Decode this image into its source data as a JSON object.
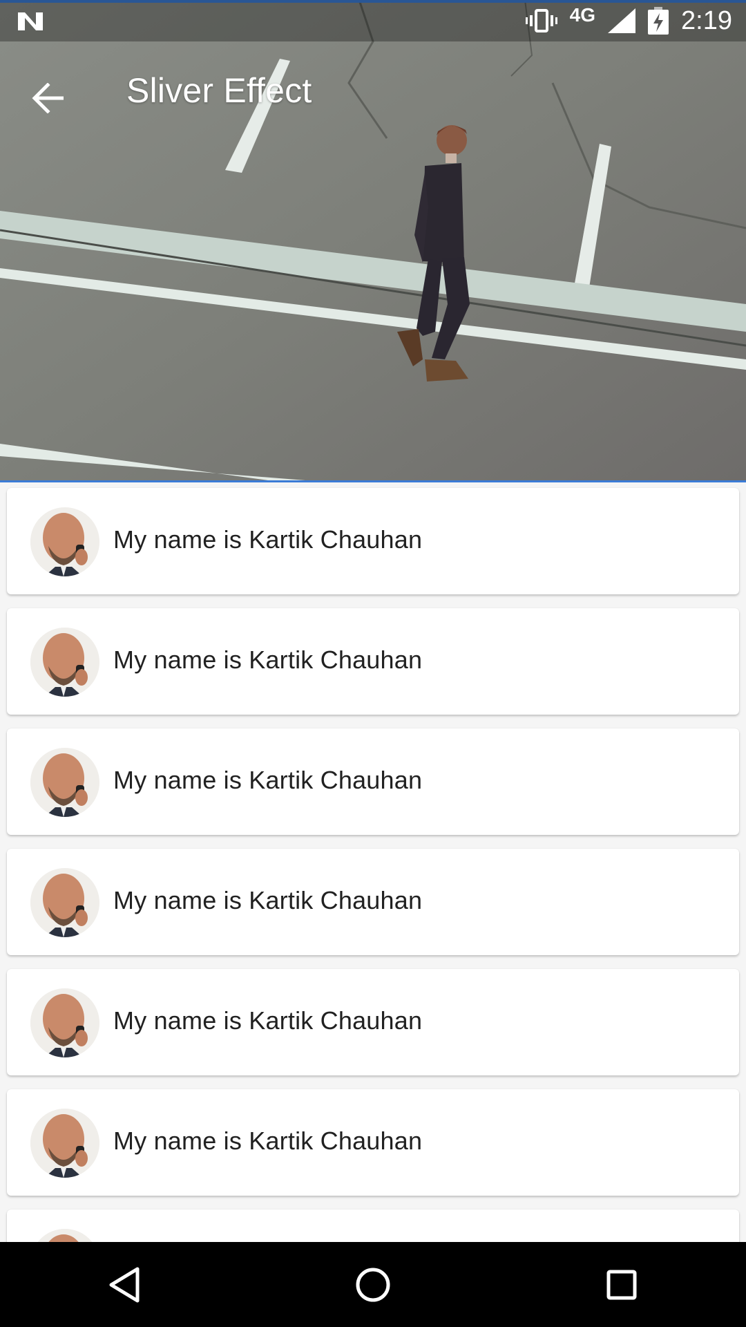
{
  "status_bar": {
    "time": "2:19",
    "network": "4G",
    "icons": [
      "notification-n-icon",
      "vibrate-icon",
      "signal-icon",
      "battery-charging-icon"
    ]
  },
  "app_bar": {
    "title": "Sliver Effect",
    "back_icon": "back-arrow-icon"
  },
  "list": {
    "items": [
      {
        "text": "My name is Kartik Chauhan",
        "avatar": "avatar-man-on-phone"
      },
      {
        "text": "My name is Kartik Chauhan",
        "avatar": "avatar-man-on-phone"
      },
      {
        "text": "My name is Kartik Chauhan",
        "avatar": "avatar-man-on-phone"
      },
      {
        "text": "My name is Kartik Chauhan",
        "avatar": "avatar-man-on-phone"
      },
      {
        "text": "My name is Kartik Chauhan",
        "avatar": "avatar-man-on-phone"
      },
      {
        "text": "My name is Kartik Chauhan",
        "avatar": "avatar-man-on-phone"
      }
    ]
  },
  "nav_bar": {
    "buttons": [
      "back-triangle-icon",
      "home-circle-icon",
      "recents-square-icon"
    ]
  },
  "colors": {
    "accent": "#3b7bd6",
    "card_bg": "#ffffff",
    "page_bg": "#f5f5f5",
    "text": "#212121"
  }
}
